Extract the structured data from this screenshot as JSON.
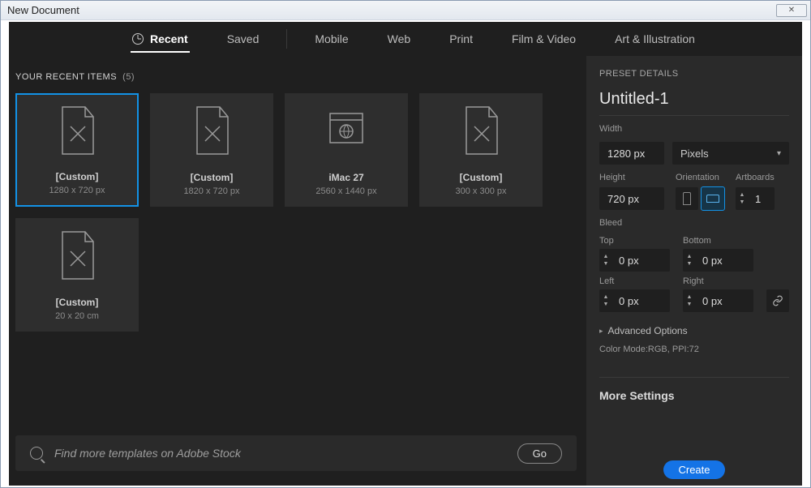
{
  "window": {
    "title": "New Document"
  },
  "tabs": {
    "recent": "Recent",
    "saved": "Saved",
    "mobile": "Mobile",
    "web": "Web",
    "print": "Print",
    "film": "Film & Video",
    "art": "Art & Illustration"
  },
  "section": {
    "label": "YOUR RECENT ITEMS",
    "count": "(5)"
  },
  "cards": [
    {
      "name": "[Custom]",
      "dims": "1280 x 720 px"
    },
    {
      "name": "[Custom]",
      "dims": "1820 x 720 px"
    },
    {
      "name": "iMac 27",
      "dims": "2560 x 1440 px"
    },
    {
      "name": "[Custom]",
      "dims": "300 x 300 px"
    },
    {
      "name": "[Custom]",
      "dims": "20 x 20 cm"
    }
  ],
  "search": {
    "placeholder": "Find more templates on Adobe Stock",
    "go": "Go"
  },
  "panel": {
    "heading": "PRESET DETAILS",
    "doc_title": "Untitled-1",
    "width_label": "Width",
    "width_value": "1280 px",
    "unit": "Pixels",
    "height_label": "Height",
    "height_value": "720 px",
    "orientation_label": "Orientation",
    "artboards_label": "Artboards",
    "artboards_value": "1",
    "bleed_label": "Bleed",
    "top_label": "Top",
    "bottom_label": "Bottom",
    "left_label": "Left",
    "right_label": "Right",
    "bleed_top": "0 px",
    "bleed_bottom": "0 px",
    "bleed_left": "0 px",
    "bleed_right": "0 px",
    "advanced": "Advanced Options",
    "mode_line": "Color Mode:RGB, PPI:72",
    "more_settings": "More Settings",
    "create": "Create"
  }
}
